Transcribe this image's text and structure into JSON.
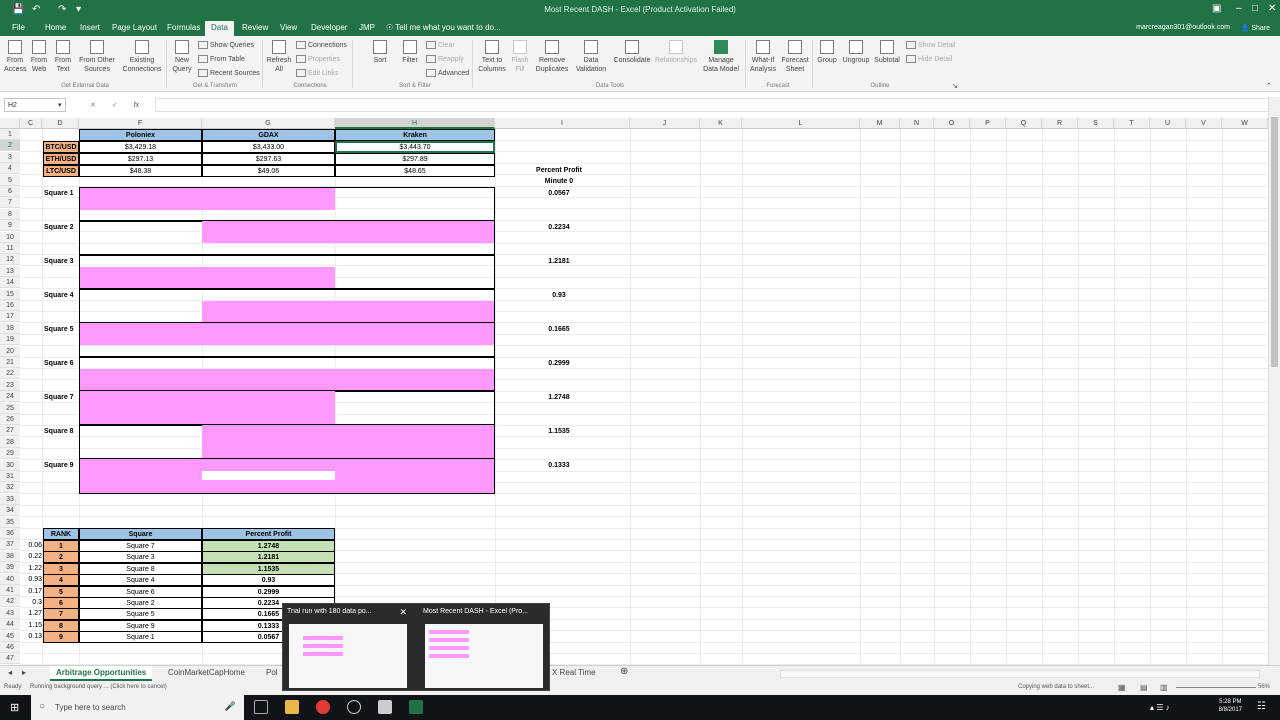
{
  "window": {
    "title": "Most Recent DASH - Excel (Product Activation Failed)",
    "account": "marcreagan301@outlook.com",
    "share_label": "Share"
  },
  "ribbon_tabs": [
    "File",
    "Home",
    "Insert",
    "Page Layout",
    "Formulas",
    "Data",
    "Review",
    "View",
    "Developer",
    "JMP"
  ],
  "active_tab": "Data",
  "tell_me": "Tell me what you want to do...",
  "ribbon": {
    "from_access": "From Access",
    "from_web": "From Web",
    "from_text": "From Text",
    "from_other": "From Other Sources",
    "existing_connections": "Existing Connections",
    "new_query": "New Query",
    "show_queries": "Show Queries",
    "from_table": "From Table",
    "recent_sources": "Recent Sources",
    "refresh_all": "Refresh All",
    "connections": "Connections",
    "properties": "Properties",
    "edit_links": "Edit Links",
    "sort": "Sort",
    "filter": "Filter",
    "clear": "Clear",
    "reapply": "Reapply",
    "advanced": "Advanced",
    "text_to_columns": "Text to Columns",
    "flash_fill": "Flash Fill",
    "remove_duplicates": "Remove Duplicates",
    "data_validation": "Data Validation",
    "consolidate": "Consolidate",
    "relationships": "Relationships",
    "manage_data_model": "Manage Data Model",
    "what_if": "What-If Analysis",
    "forecast_sheet": "Forecast Sheet",
    "group": "Group",
    "ungroup": "Ungroup",
    "subtotal": "Subtotal",
    "show_detail": "Show Detail",
    "hide_detail": "Hide Detail",
    "groups": [
      "Get External Data",
      "Get & Transform",
      "Connections",
      "Sort & Filter",
      "Data Tools",
      "Forecast",
      "Outline"
    ]
  },
  "formula_bar": {
    "name_box": "H2",
    "fx": "fx",
    "value": ""
  },
  "columns": [
    "C",
    "D",
    "F",
    "G",
    "H",
    "I",
    "J",
    "K",
    "L",
    "M",
    "N",
    "O",
    "P",
    "Q",
    "R",
    "S",
    "T",
    "U",
    "V",
    "W"
  ],
  "rows": [
    "1",
    "2",
    "3",
    "4",
    "5",
    "6",
    "7",
    "8",
    "9",
    "10",
    "11",
    "12",
    "13",
    "14",
    "15",
    "16",
    "17",
    "18",
    "19",
    "20",
    "21",
    "22",
    "23",
    "24",
    "25",
    "26",
    "27",
    "28",
    "29",
    "30",
    "31",
    "32",
    "33",
    "34",
    "35",
    "36",
    "37",
    "38",
    "39",
    "40",
    "41",
    "42",
    "43",
    "44",
    "45",
    "46",
    "47"
  ],
  "exchange_table": {
    "headers": [
      "Poloniex",
      "GDAX",
      "Kraken"
    ],
    "pairs": [
      {
        "pair": "BTC/USD",
        "prices": [
          "$3,429.18",
          "$3,433.00",
          "$3,443.70"
        ]
      },
      {
        "pair": "ETH/USD",
        "prices": [
          "$297.13",
          "$297.63",
          "$297.89"
        ]
      },
      {
        "pair": "LTC/USD",
        "prices": [
          "$48.38",
          "$49.06",
          "$48.65"
        ]
      }
    ]
  },
  "percent_profit_header": "Percent Profit",
  "minute_label": "Minute 0",
  "squares": [
    {
      "label": "Square 1",
      "profit": "0.0567"
    },
    {
      "label": "Square 2",
      "profit": "0.2234"
    },
    {
      "label": "Square 3",
      "profit": "1.2181"
    },
    {
      "label": "Square 4",
      "profit": "0.93"
    },
    {
      "label": "Square 5",
      "profit": "0.1665"
    },
    {
      "label": "Square 6",
      "profit": "0.2999"
    },
    {
      "label": "Square 7",
      "profit": "1.2748"
    },
    {
      "label": "Square 8",
      "profit": "1.1535"
    },
    {
      "label": "Square 9",
      "profit": "0.1333"
    }
  ],
  "rank_table": {
    "headers": [
      "RANK",
      "Square",
      "Percent Profit"
    ],
    "rows": [
      {
        "left": "0.06",
        "rank": "1",
        "square": "Square 7",
        "profit": "1.2748"
      },
      {
        "left": "0.22",
        "rank": "2",
        "square": "Square 3",
        "profit": "1.2181"
      },
      {
        "left": "1.22",
        "rank": "3",
        "square": "Square 8",
        "profit": "1.1535"
      },
      {
        "left": "0.93",
        "rank": "4",
        "square": "Square 4",
        "profit": "0.93"
      },
      {
        "left": "0.17",
        "rank": "5",
        "square": "Square 6",
        "profit": "0.2999"
      },
      {
        "left": "0.3",
        "rank": "6",
        "square": "Square 2",
        "profit": "0.2234"
      },
      {
        "left": "1.27",
        "rank": "7",
        "square": "Square 5",
        "profit": "0.1665"
      },
      {
        "left": "1.15",
        "rank": "8",
        "square": "Square 9",
        "profit": "0.1333"
      },
      {
        "left": "0.13",
        "rank": "9",
        "square": "Square 1",
        "profit": "0.0567"
      }
    ]
  },
  "sheet_tabs": [
    "Arbitrage Opportunities",
    "CoinMarketCapHome",
    "Pol",
    "X Real Time"
  ],
  "status": {
    "ready": "Ready",
    "background": "Running background query ... (Click here to cancel)",
    "copying": "Copying web data to sheet...",
    "zoom": "56%"
  },
  "taskbar": {
    "search_placeholder": "Type here to search",
    "time": "5:28 PM",
    "date": "8/8/2017"
  },
  "thumbnails": [
    {
      "title": "Trial run with 180 data po..."
    },
    {
      "title": "Most Recent DASH - Excel (Pro..."
    }
  ]
}
